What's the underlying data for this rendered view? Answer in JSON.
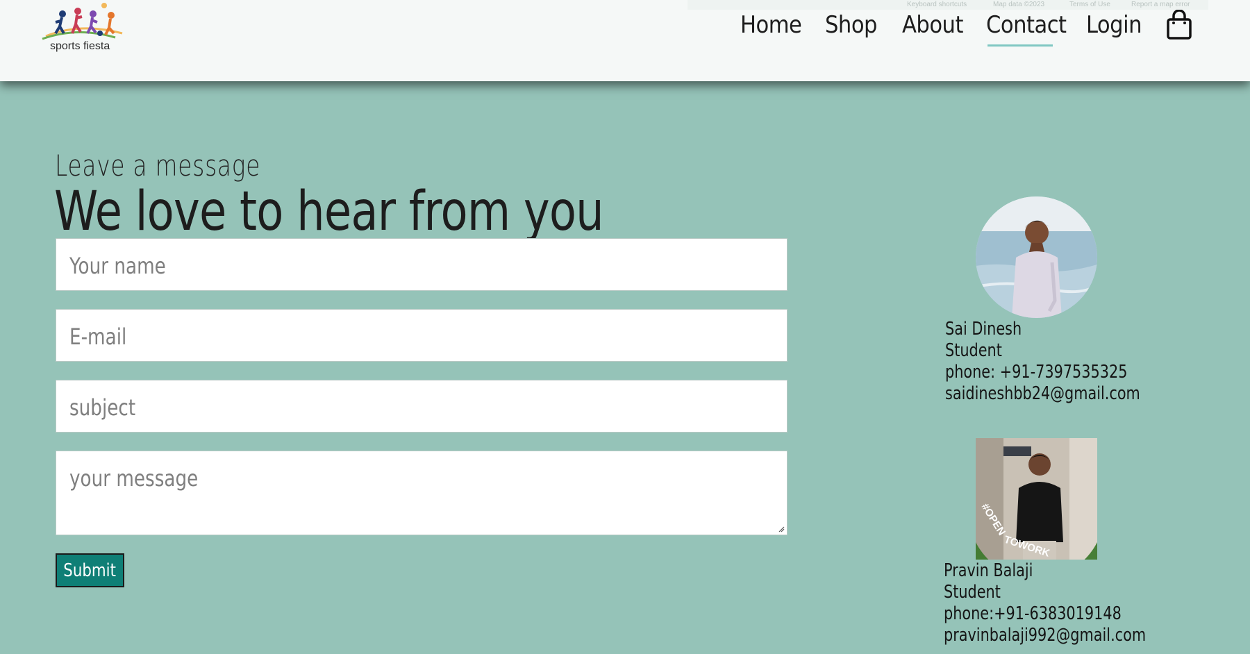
{
  "header": {
    "logo_text": "sports fiesta",
    "map_attribution": [
      "Keyboard shortcuts",
      "Map data ©2023",
      "Terms of Use",
      "Report a map error"
    ],
    "nav": [
      {
        "label": "Home",
        "active": false
      },
      {
        "label": "Shop",
        "active": false
      },
      {
        "label": "About",
        "active": false
      },
      {
        "label": "Contact",
        "active": true
      },
      {
        "label": "Login",
        "active": false
      }
    ],
    "cart_icon": "shopping-bag-icon"
  },
  "form": {
    "kicker": "Leave a message",
    "headline": "We love to hear from you",
    "name_placeholder": "Your name",
    "email_placeholder": "E-mail",
    "subject_placeholder": "subject",
    "message_placeholder": "your message",
    "submit_label": "Submit"
  },
  "contacts": [
    {
      "name": "Sai Dinesh",
      "role": "Student",
      "phone": "phone: +91-7397535325",
      "email": "saidineshbb24@gmail.com"
    },
    {
      "name": "Pravin Balaji",
      "role": "Student",
      "phone": "phone:+91-6383019148",
      "email": "pravinbalaji992@gmail.com",
      "badge": "#OPENTOWORK"
    }
  ],
  "colors": {
    "page_bg": "#95c3b8",
    "header_bg": "#f5f8f7",
    "submit_bg": "#0f7f76",
    "nav_underline": "#7fc7c2"
  }
}
